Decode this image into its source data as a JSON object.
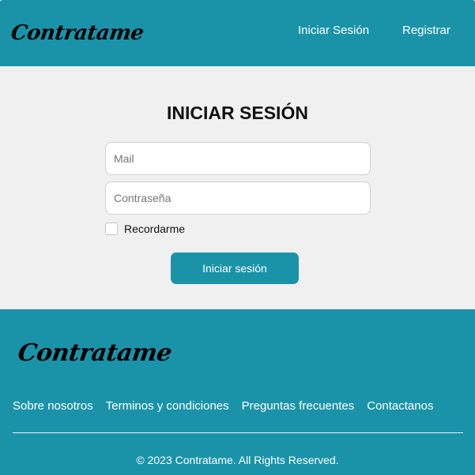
{
  "header": {
    "logo_text": "Contratame",
    "nav": {
      "login_label": "Iniciar Sesión",
      "register_label": "Registrar"
    }
  },
  "login": {
    "title": "INICIAR SESIÓN",
    "mail_placeholder": "Mail",
    "password_placeholder": "Contraseña",
    "remember_label": "Recordarme",
    "remember_checked": false,
    "submit_label": "Iniciar sesión"
  },
  "footer": {
    "logo_text": "Contratame",
    "links": [
      "Sobre nosotros",
      "Terminos y condiciones",
      "Preguntas frecuentes",
      "Contactanos"
    ],
    "copyright": "© 2023 Contratame. All Rights Reserved."
  },
  "colors": {
    "brand": "#1a93a9",
    "background": "#f0f0f0"
  }
}
